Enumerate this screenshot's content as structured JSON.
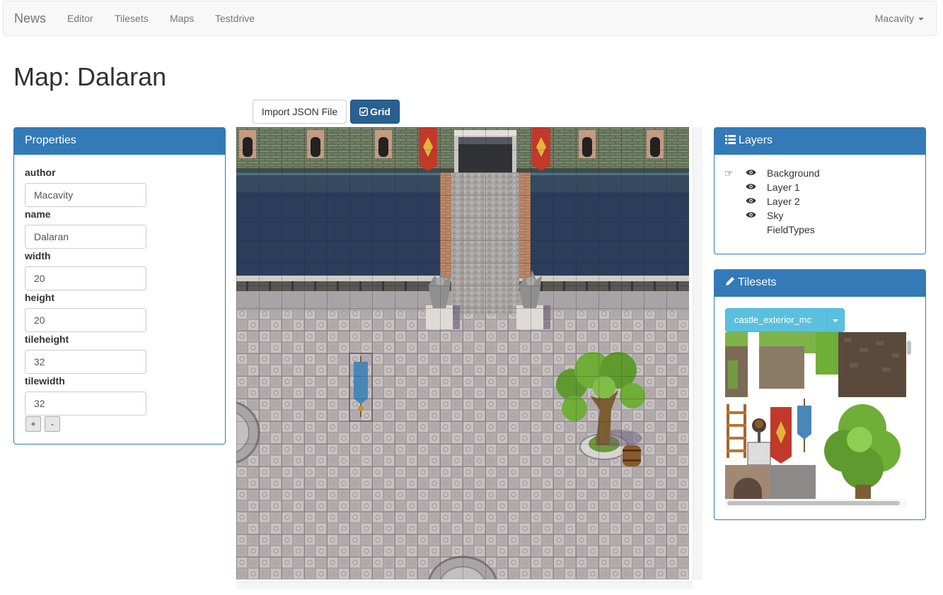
{
  "navbar": {
    "brand": "News",
    "links": [
      "Editor",
      "Tilesets",
      "Maps",
      "Testdrive"
    ],
    "user": "Macavity"
  },
  "page": {
    "title": "Map: Dalaran"
  },
  "toolbar": {
    "import_label": "Import JSON File",
    "grid_label": "Grid",
    "grid_icon": "check-square-icon"
  },
  "properties": {
    "title": "Properties",
    "fields": [
      {
        "label": "author",
        "value": "Macavity"
      },
      {
        "label": "name",
        "value": "Dalaran"
      },
      {
        "label": "width",
        "value": "20"
      },
      {
        "label": "height",
        "value": "20"
      },
      {
        "label": "tileheight",
        "value": "32"
      },
      {
        "label": "tilewidth",
        "value": "32"
      }
    ],
    "add_label": "+",
    "remove_label": "-"
  },
  "layers": {
    "title": "Layers",
    "items": [
      {
        "name": "Background",
        "visible": true,
        "active": true
      },
      {
        "name": "Layer 1",
        "visible": true,
        "active": false
      },
      {
        "name": "Layer 2",
        "visible": true,
        "active": false
      },
      {
        "name": "Sky",
        "visible": true,
        "active": false
      },
      {
        "name": "FieldTypes",
        "visible": false,
        "active": false
      }
    ]
  },
  "tilesets": {
    "title": "Tilesets",
    "selected": "castle_exterior_mc"
  },
  "colors": {
    "primary": "#337ab7",
    "primary_dark": "#286090",
    "info": "#5bc0de",
    "water": "#2b3d5a",
    "stone_floor": "#bdb7b8"
  }
}
